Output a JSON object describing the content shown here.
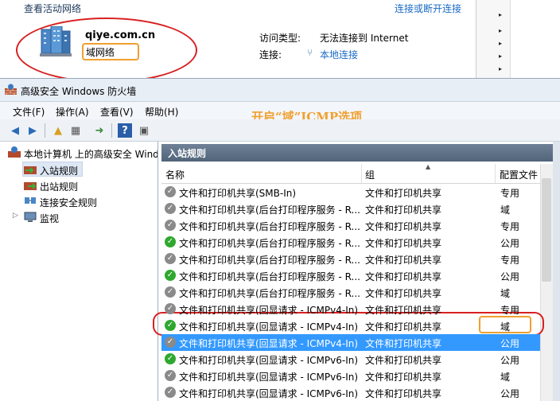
{
  "network": {
    "section_title": "查看活动网络",
    "connect_link": "连接或断开连接",
    "name": "qiye.com.cn",
    "type": "域网络",
    "access_label": "访问类型:",
    "access_value": "无法连接到 Internet",
    "conn_label": "连接:",
    "conn_value": "本地连接"
  },
  "window": {
    "title": "高级安全 Windows 防火墙",
    "menu": [
      "文件(F)",
      "操作(A)",
      "查看(V)",
      "帮助(H)"
    ],
    "annotation": "开启“域”ICMP选项"
  },
  "tree": {
    "root": "本地计算机 上的高级安全 Wind",
    "items": [
      "入站规则",
      "出站规则",
      "连接安全规则",
      "监视"
    ]
  },
  "pane": {
    "header": "入站规则",
    "columns": [
      "名称",
      "组",
      "配置文件"
    ],
    "rows": [
      {
        "name": "文件和打印机共享(SMB-In)",
        "group": "文件和打印机共享",
        "profile": "专用",
        "enabled": false
      },
      {
        "name": "文件和打印机共享(后台打印程序服务 - R...",
        "group": "文件和打印机共享",
        "profile": "域",
        "enabled": false
      },
      {
        "name": "文件和打印机共享(后台打印程序服务 - R...",
        "group": "文件和打印机共享",
        "profile": "专用",
        "enabled": false
      },
      {
        "name": "文件和打印机共享(后台打印程序服务 - R...",
        "group": "文件和打印机共享",
        "profile": "公用",
        "enabled": true
      },
      {
        "name": "文件和打印机共享(后台打印程序服务 - R...",
        "group": "文件和打印机共享",
        "profile": "专用",
        "enabled": false
      },
      {
        "name": "文件和打印机共享(后台打印程序服务 - R...",
        "group": "文件和打印机共享",
        "profile": "公用",
        "enabled": true
      },
      {
        "name": "文件和打印机共享(后台打印程序服务 - R...",
        "group": "文件和打印机共享",
        "profile": "域",
        "enabled": false
      },
      {
        "name": "文件和打印机共享(回显请求 - ICMPv4-In)",
        "group": "文件和打印机共享",
        "profile": "专用",
        "enabled": false
      },
      {
        "name": "文件和打印机共享(回显请求 - ICMPv4-In)",
        "group": "文件和打印机共享",
        "profile": "域",
        "enabled": true
      },
      {
        "name": "文件和打印机共享(回显请求 - ICMPv4-In)",
        "group": "文件和打印机共享",
        "profile": "公用",
        "enabled": false
      },
      {
        "name": "文件和打印机共享(回显请求 - ICMPv6-In)",
        "group": "文件和打印机共享",
        "profile": "公用",
        "enabled": true
      },
      {
        "name": "文件和打印机共享(回显请求 - ICMPv6-In)",
        "group": "文件和打印机共享",
        "profile": "域",
        "enabled": false
      },
      {
        "name": "文件和打印机共享(回显请求 - ICMPv6-In)",
        "group": "文件和打印机共享",
        "profile": "公用",
        "enabled": false
      }
    ]
  },
  "icons": {
    "network": "domain-network-icon",
    "connection": "network-adapter-icon",
    "firewall": "firewall-icon",
    "enabled": "check-circle-icon",
    "disabled": "gray-circle-icon"
  },
  "colors": {
    "highlight_oval": "#d82020",
    "highlight_box": "#f0a030",
    "selection": "#3399ff",
    "enabled": "#2ea82e",
    "link": "#1a6bc6"
  }
}
